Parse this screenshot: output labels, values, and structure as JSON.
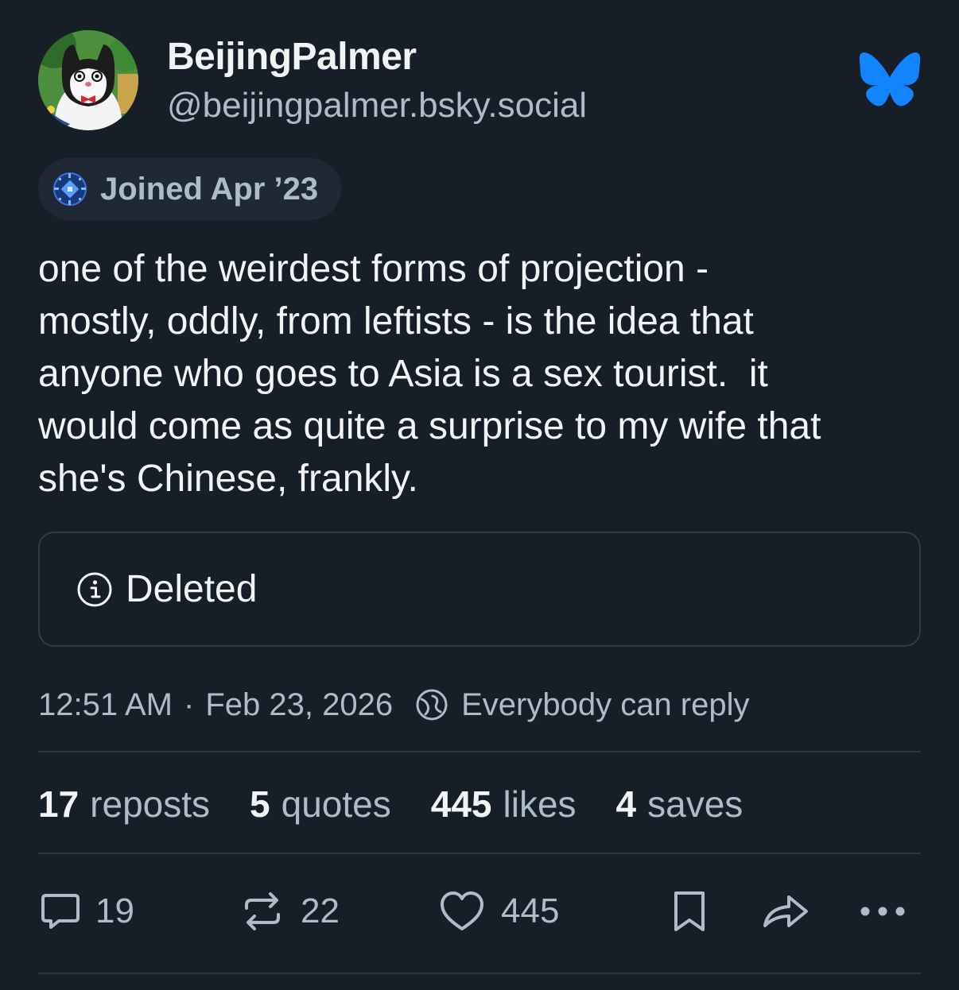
{
  "author": {
    "display_name": "BeijingPalmer",
    "handle": "@beijingpalmer.bsky.social"
  },
  "joined_badge": "Joined Apr ’23",
  "post": {
    "text": "one of the weirdest forms of projection -\nmostly, oddly, from leftists - is the idea that\nanyone who goes to Asia is a sex tourist.  it\nwould come as quite a surprise to my wife that\nshe's Chinese, frankly."
  },
  "embed": {
    "icon": "info-icon",
    "label": "Deleted"
  },
  "meta": {
    "time": "12:51 AM",
    "separator": "·",
    "date": "Feb 23, 2026",
    "reply_setting": "Everybody can reply"
  },
  "stats": {
    "reposts_count": "17",
    "reposts_label": "reposts",
    "quotes_count": "5",
    "quotes_label": "quotes",
    "likes_count": "445",
    "likes_label": "likes",
    "saves_count": "4",
    "saves_label": "saves"
  },
  "actions": {
    "reply_count": "19",
    "repost_count": "22",
    "like_count": "445"
  },
  "colors": {
    "background": "#161e27",
    "text_primary": "#f1f3f5",
    "text_secondary": "#aebbc9",
    "bluesky_blue": "#1185fe"
  },
  "icons": [
    "bluesky-butterfly-icon",
    "joined-badge-icon",
    "info-icon",
    "globe-icon",
    "reply-icon",
    "repost-icon",
    "heart-icon",
    "bookmark-icon",
    "share-icon",
    "more-icon"
  ]
}
